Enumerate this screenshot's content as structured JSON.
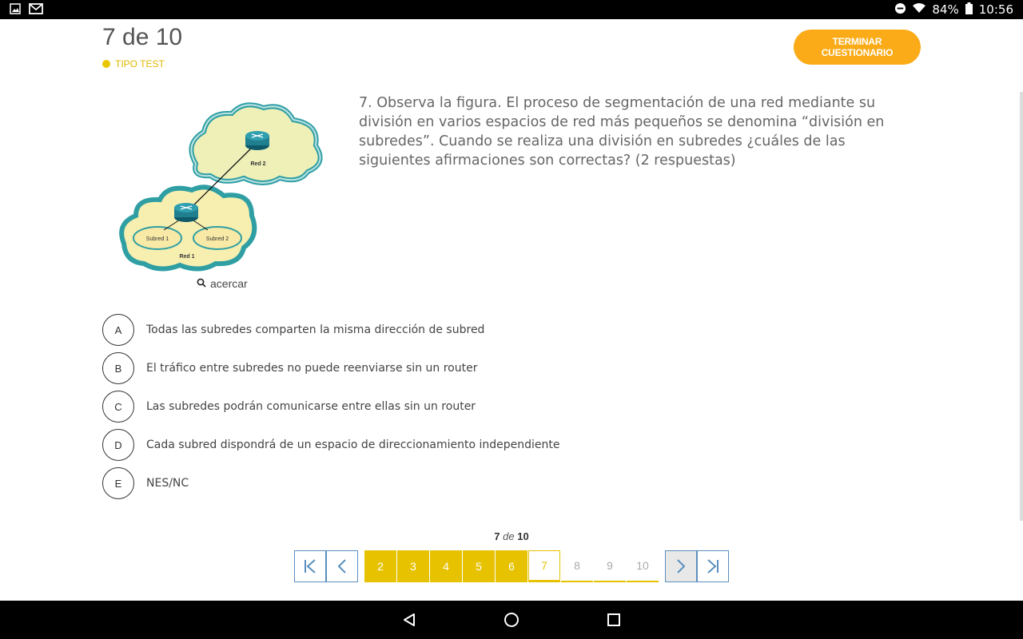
{
  "status_bar": {
    "battery": "84%",
    "time": "10:56",
    "icons": [
      "image-icon",
      "gmail-icon",
      "dnd-icon",
      "wifi-icon",
      "battery-icon"
    ]
  },
  "quiz": {
    "counter": "7 de 10",
    "type_label": "TIPO TEST",
    "finish_label": "TERMINAR CUESTIONARIO",
    "accent_color": "#fbab18",
    "yellow": "#e6c200"
  },
  "figure": {
    "cloud_top_label": "Red 2",
    "cloud_bottom_label": "Red 1",
    "subnet1_label": "Subred 1",
    "subnet2_label": "Subred 2",
    "zoom_label": "acercar"
  },
  "question": {
    "text": "7. Observa la figura. El proceso de segmentación de una red mediante su división en varios espacios de red más pequeños se denomina “división en subredes”. Cuando se realiza una división en subredes ¿cuáles de las siguientes afirmaciones son correctas? (2 respuestas)"
  },
  "answers": [
    {
      "letter": "A",
      "text": "Todas las subredes comparten la misma dirección de subred"
    },
    {
      "letter": "B",
      "text": "El tráfico entre subredes no puede reenviarse sin un router"
    },
    {
      "letter": "C",
      "text": "Las subredes podrán comunicarse entre ellas sin un router"
    },
    {
      "letter": "D",
      "text": "Cada subred dispondrá de un espacio de direccionamiento independiente"
    },
    {
      "letter": "E",
      "text": "NES/NC"
    }
  ],
  "pager": {
    "current": "7",
    "de": "de",
    "total": "10",
    "pages": [
      "2",
      "3",
      "4",
      "5",
      "6",
      "7",
      "8",
      "9",
      "10"
    ]
  }
}
